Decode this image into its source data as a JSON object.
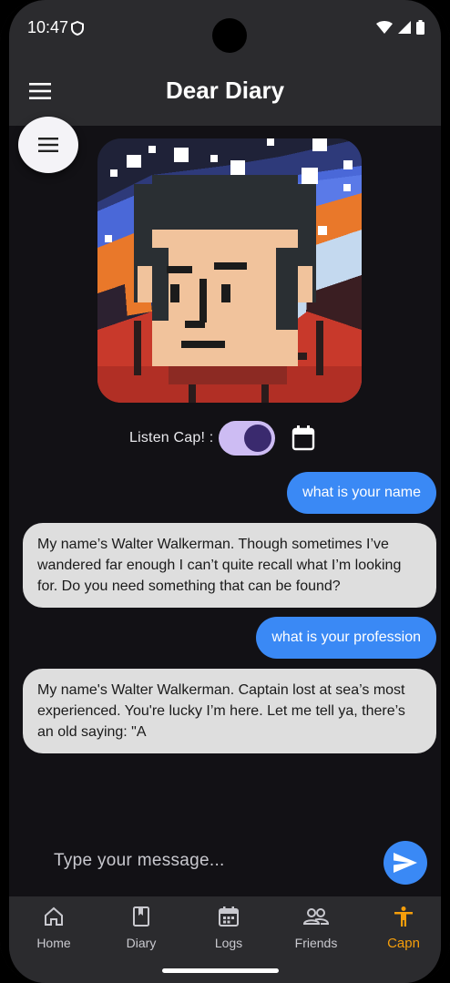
{
  "status_bar": {
    "time": "10:47"
  },
  "app_bar": {
    "title": "Dear Diary"
  },
  "controls": {
    "listen_label": "Listen Cap! :",
    "listen_on": true
  },
  "messages": [
    {
      "role": "user",
      "text": "what is your name"
    },
    {
      "role": "bot",
      "text": "My name’s Walter Walkerman. Though sometimes I’ve wandered far enough I can’t quite recall what I’m looking for. Do you need something that can be found?"
    },
    {
      "role": "user",
      "text": "what is your profession"
    },
    {
      "role": "bot",
      "text": "My name's Walter Walkerman. Captain lost at sea’s most experienced. You're lucky I’m here. Let me tell ya, there’s an old saying: \"A"
    }
  ],
  "composer": {
    "placeholder": "Type your message..."
  },
  "nav": [
    {
      "label": "Home",
      "icon": "home-icon"
    },
    {
      "label": "Diary",
      "icon": "book-icon"
    },
    {
      "label": "Logs",
      "icon": "calendar-icon"
    },
    {
      "label": "Friends",
      "icon": "people-icon"
    },
    {
      "label": "Capn",
      "icon": "person-icon",
      "active": true
    }
  ],
  "colors": {
    "accent": "#3a89f5",
    "active_nav": "#f59e0b",
    "switch_track": "#cdbcf3",
    "switch_knob": "#3a2a6e"
  }
}
